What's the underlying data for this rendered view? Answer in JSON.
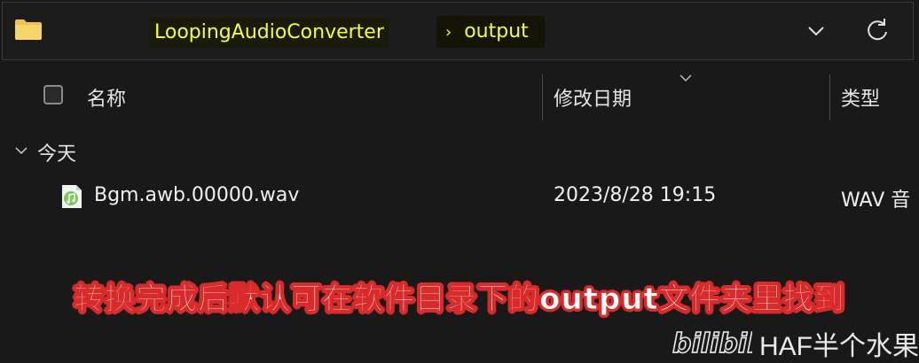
{
  "address_bar": {
    "breadcrumb": [
      "LoopingAudioConverter",
      "output"
    ],
    "separator": "›",
    "icons": [
      "folder-icon",
      "chevron-down-icon",
      "refresh-icon"
    ],
    "highlight_color": "#f2ff3a"
  },
  "columns": {
    "name": "名称",
    "date_modified": "修改日期",
    "type": "类型"
  },
  "groups": [
    {
      "label": "今天",
      "files": [
        {
          "name": "Bgm.awb.00000.wav",
          "date": "2023/8/28 19:15",
          "type": "WAV 音",
          "icon": "audio-file-icon"
        }
      ]
    }
  ],
  "caption": "转换完成后默认可在软件目录下的output文件夹里找到",
  "caption_outline_color": "#d92b2b",
  "watermark": {
    "logo": "bilibili",
    "text": "HAF半个水果"
  }
}
